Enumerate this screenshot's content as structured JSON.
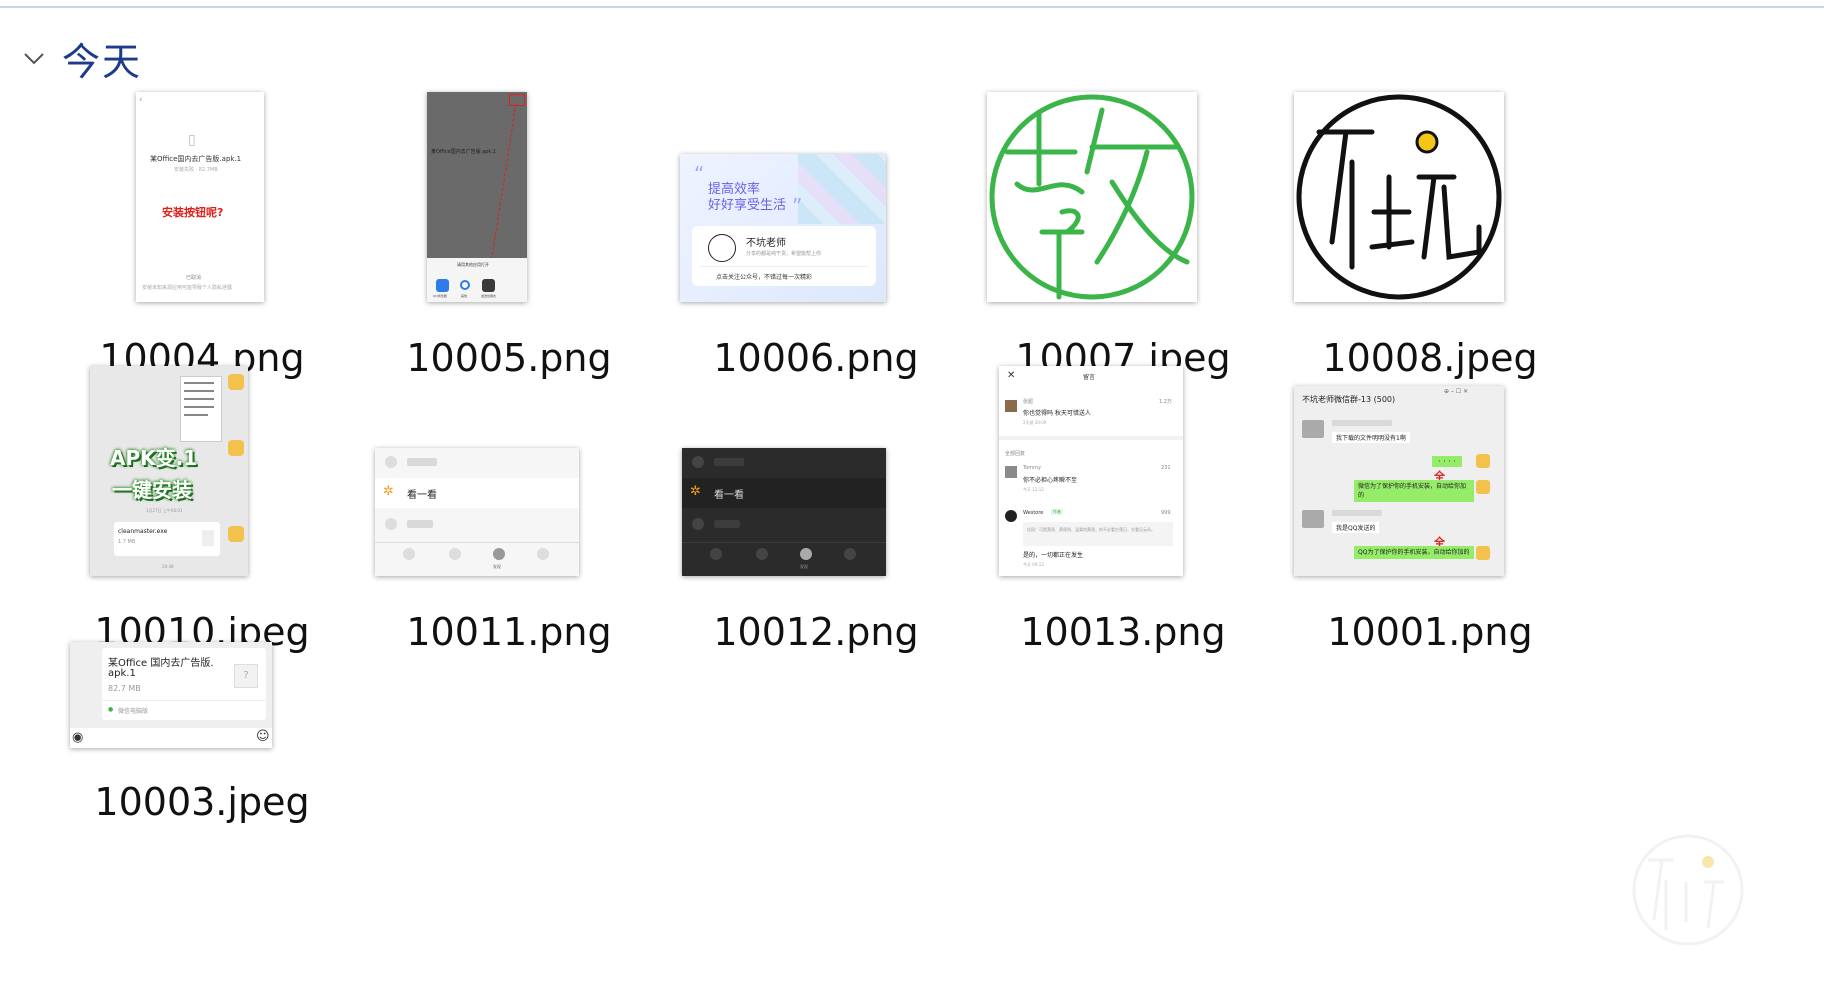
{
  "header": {
    "title": "今天"
  },
  "files": [
    {
      "id": "10004",
      "name": "10004.png",
      "text": {
        "title": "某Office国内去广告版.apk.1",
        "meta": "安装失败 · 82.7MB",
        "red": "安装按钮呢?",
        "foot1": "已取消",
        "foot2": "安装未知来源应用可能导致个人隐私泄露"
      }
    },
    {
      "id": "10005",
      "name": "10005.png",
      "text": {
        "title": "某Office国内去广告版.apk.1",
        "bar": "请用其他应用打开",
        "a1": "QQ浏览器",
        "a2": "其他",
        "a3": "发送给朋友"
      }
    },
    {
      "id": "10006",
      "name": "10006.png",
      "text": {
        "slogan1": "提高效率",
        "slogan2": "好好享受生活",
        "name": "不坑老师",
        "desc": "分享的都是纯干货，希望能帮上你",
        "cta": "点击关注公众号，不错过每一次精彩"
      }
    },
    {
      "id": "10007",
      "name": "10007.jpeg",
      "text": {}
    },
    {
      "id": "10008",
      "name": "10008.jpeg",
      "text": {}
    },
    {
      "id": "10010",
      "name": "10010.jpeg",
      "text": {
        "big1": "APK变.1",
        "big2": "一键安装",
        "time": "1月27日 上午08:01",
        "file": "cleanmaster.exe",
        "size": "1.7 MB",
        "bottom": "20:48"
      }
    },
    {
      "id": "10011",
      "name": "10011.png",
      "text": {
        "item": "看一看",
        "tab": "发现"
      }
    },
    {
      "id": "10012",
      "name": "10012.png",
      "text": {
        "item": "看一看",
        "tab": "发现"
      }
    },
    {
      "id": "10013",
      "name": "10013.png",
      "text": {
        "title": "留言",
        "u1": "张超",
        "c1": "你也觉得吗 秋天可惜送人",
        "d1": "2天前 20:09",
        "l1": "1.2万",
        "sec": "全部回复",
        "u2": "Tommy",
        "c2": "你不必担心疼瞬不至",
        "d2": "今天 12:12",
        "l2": "231",
        "u3": "Westore",
        "tag": "作者",
        "l3": "999",
        "quote": "佳园：可是黄昏、黄昏则、温柔的黄昏。你不必看它落日、光看见云朵。",
        "c3": "是的，一切都正在发生",
        "d3": "今天 09:13"
      }
    },
    {
      "id": "10001",
      "name": "10001.png",
      "text": {
        "title": "不坑老师微信群-13 (500)",
        "m1": "我下载的文件明明没有1啊",
        "dots": "· · · ·",
        "full": "全",
        "m2": "微信为了保护你的手机安装，自动给你加的",
        "m3": "我是QQ发送的",
        "m4": "QQ为了保护你的手机安装，自动给你加的"
      }
    },
    {
      "id": "10003",
      "name": "10003.jpeg",
      "text": {
        "title1": "某Office 国内去广告版.",
        "title2": "apk.1",
        "size": "82.7 MB",
        "src": "微信电脑版"
      }
    }
  ],
  "colors": {
    "accent": "#1e3b8a",
    "green": "#3bb54a",
    "red": "#e0201b"
  }
}
